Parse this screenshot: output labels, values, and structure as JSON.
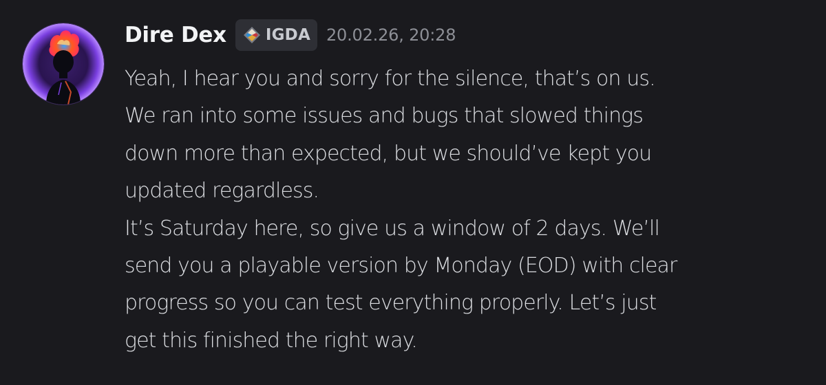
{
  "message": {
    "author": {
      "name": "Dire Dex",
      "avatar_icon": "flaming-head-avatar-icon",
      "tag": {
        "icon": "diamond-guild-badge-icon",
        "label": "IGDA"
      }
    },
    "timestamp": "20.02.26, 20:28",
    "lines": [
      "Yeah, I hear you and sorry for the silence, that’s on us.",
      "We ran into some issues and bugs that slowed things",
      "down more than expected, but we should’ve kept you",
      "updated regardless.",
      "It’s Saturday here, so give us a window of 2 days. We’ll",
      "send you a playable version by Monday (EOD) with clear",
      "progress so you can test everything properly. Let’s just",
      "get this finished the right way."
    ]
  },
  "colors": {
    "background": "#1a1a1e",
    "username": "#f2f3f5",
    "text": "#dcdee2",
    "timestamp": "#8d8f96",
    "tag_background": "#2e2f35",
    "avatar_glow": "#8a4dff"
  }
}
